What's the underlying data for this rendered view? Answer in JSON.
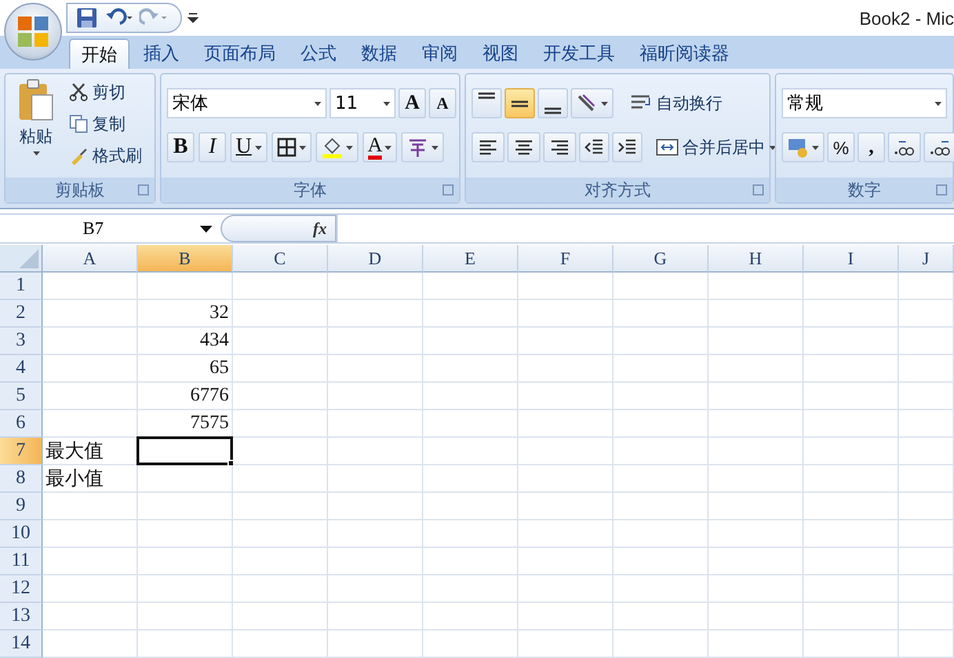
{
  "window": {
    "title": "Book2 - Mic"
  },
  "tabs": [
    {
      "label": "开始",
      "selected": true
    },
    {
      "label": "插入",
      "selected": false
    },
    {
      "label": "页面布局",
      "selected": false
    },
    {
      "label": "公式",
      "selected": false
    },
    {
      "label": "数据",
      "selected": false
    },
    {
      "label": "审阅",
      "selected": false
    },
    {
      "label": "视图",
      "selected": false
    },
    {
      "label": "开发工具",
      "selected": false
    },
    {
      "label": "福昕阅读器",
      "selected": false
    }
  ],
  "clipboard": {
    "paste": "粘贴",
    "cut": "剪切",
    "copy": "复制",
    "format_painter": "格式刷",
    "label": "剪贴板"
  },
  "font": {
    "name": "宋体",
    "size": "11",
    "grow": "A",
    "shrink": "A",
    "bold": "B",
    "italic": "I",
    "underline": "U",
    "font_color": "A",
    "label": "字体"
  },
  "alignment": {
    "vertical_align": [
      {
        "selected": false
      },
      {
        "selected": true
      },
      {
        "selected": false
      }
    ],
    "wrap_text": "自动换行",
    "merge": "合并后居中",
    "label": "对齐方式"
  },
  "number": {
    "format": "常规",
    "percent": "%",
    "comma": ",",
    "label": "数字"
  },
  "formula_bar": {
    "name_box": "B7",
    "fx": "fx"
  },
  "sheet": {
    "columns": [
      {
        "label": "A",
        "selected": false
      },
      {
        "label": "B",
        "selected": true
      },
      {
        "label": "C",
        "selected": false
      },
      {
        "label": "D",
        "selected": false
      },
      {
        "label": "E",
        "selected": false
      },
      {
        "label": "F",
        "selected": false
      },
      {
        "label": "G",
        "selected": false
      },
      {
        "label": "H",
        "selected": false
      },
      {
        "label": "I",
        "selected": false
      },
      {
        "label": "J",
        "selected": false
      }
    ],
    "rows": [
      {
        "number": "1",
        "selected": false,
        "cells": [
          {
            "selected": false
          },
          {
            "selected": false
          }
        ]
      },
      {
        "number": "2",
        "selected": false,
        "cells": [
          {
            "selected": false
          },
          {
            "text": "32",
            "selected": false
          }
        ]
      },
      {
        "number": "3",
        "selected": false,
        "cells": [
          {
            "selected": false
          },
          {
            "text": "434",
            "selected": false
          }
        ]
      },
      {
        "number": "4",
        "selected": false,
        "cells": [
          {
            "selected": false
          },
          {
            "text": "65",
            "selected": false
          }
        ]
      },
      {
        "number": "5",
        "selected": false,
        "cells": [
          {
            "selected": false
          },
          {
            "text": "6776",
            "selected": false
          }
        ]
      },
      {
        "number": "6",
        "selected": false,
        "cells": [
          {
            "selected": false
          },
          {
            "text": "7575",
            "selected": false
          }
        ]
      },
      {
        "number": "7",
        "selected": true,
        "cells": [
          {
            "text": "最大值",
            "selected": false
          },
          {
            "selected": true
          }
        ]
      },
      {
        "number": "8",
        "selected": false,
        "cells": [
          {
            "text": "最小值",
            "selected": false
          },
          {
            "selected": false
          }
        ]
      },
      {
        "number": "9",
        "selected": false,
        "cells": [
          {
            "selected": false
          },
          {
            "selected": false
          }
        ]
      },
      {
        "number": "10",
        "selected": false,
        "cells": [
          {
            "selected": false
          },
          {
            "selected": false
          }
        ]
      },
      {
        "number": "11",
        "selected": false,
        "cells": [
          {
            "selected": false
          },
          {
            "selected": false
          }
        ]
      },
      {
        "number": "12",
        "selected": false,
        "cells": [
          {
            "selected": false
          },
          {
            "selected": false
          }
        ]
      },
      {
        "number": "13",
        "selected": false,
        "cells": [
          {
            "selected": false
          },
          {
            "selected": false
          }
        ]
      },
      {
        "number": "14",
        "selected": false,
        "cells": [
          {
            "selected": false
          },
          {
            "selected": false
          }
        ]
      }
    ]
  }
}
